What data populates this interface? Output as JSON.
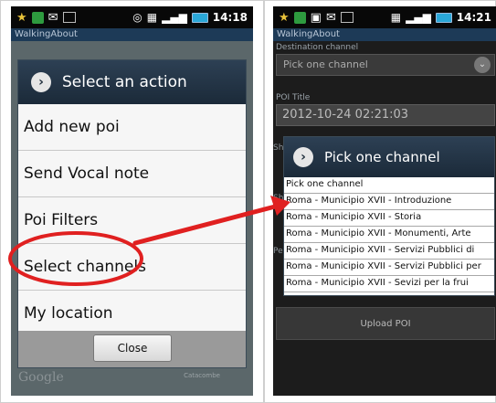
{
  "left_screen": {
    "status_time": "14:18",
    "app_title": "WalkingAbout",
    "dialog_title": "Select an action",
    "menu_items": [
      "Add new poi",
      "Send Vocal note",
      "Poi Filters",
      "Select channels",
      "My location"
    ],
    "close_label": "Close",
    "map_watermark": "Google",
    "map_place": "Catacombe"
  },
  "right_screen": {
    "status_time": "14:21",
    "app_title": "WalkingAbout",
    "destination_label": "Destination channel",
    "destination_value": "Pick one channel",
    "poi_title_label": "POI Title",
    "poi_title_value": "2012-10-24 02:21:03",
    "stub_1": "Sh",
    "stub_2": "Sh",
    "stub_3": "Pe",
    "dialog_title": "Pick one channel",
    "channel_items": [
      "Pick one channel",
      "Roma - Municipio XVII  - Introduzione",
      "Roma - Municipio XVII  - Storia",
      "Roma - Municipio XVII - Monumenti, Arte",
      "Roma - Municipio XVII - Servizi Pubblici di",
      "Roma - Municipio XVII - Servizi Pubblici per",
      "Roma - Municipio XVII - Sevizi per la frui"
    ],
    "upload_label": "Upload POI"
  },
  "colors": {
    "annotation": "#e02020",
    "header": "#1f2e3c",
    "appbar": "#1d3a57"
  }
}
